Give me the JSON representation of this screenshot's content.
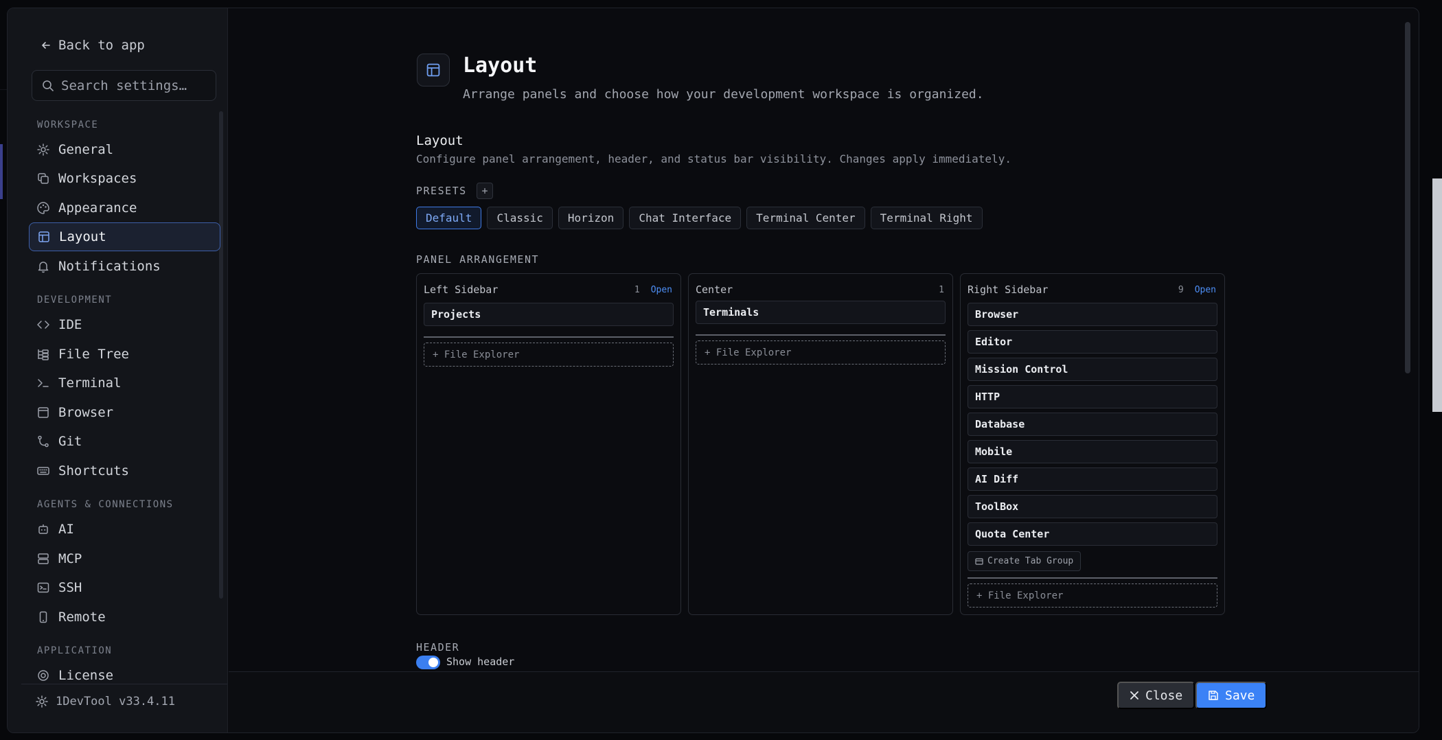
{
  "sidebar": {
    "back_label": "Back to app",
    "search_placeholder": "Search settings…",
    "groups": [
      {
        "label": "WORKSPACE"
      },
      {
        "label": "DEVELOPMENT"
      },
      {
        "label": "AGENTS & CONNECTIONS"
      },
      {
        "label": "APPLICATION"
      }
    ],
    "items": {
      "general": "General",
      "workspaces": "Workspaces",
      "appearance": "Appearance",
      "layout": "Layout",
      "notifications": "Notifications",
      "ide": "IDE",
      "file_tree": "File Tree",
      "terminal": "Terminal",
      "browser": "Browser",
      "git": "Git",
      "shortcuts": "Shortcuts",
      "ai": "AI",
      "mcp": "MCP",
      "ssh": "SSH",
      "remote": "Remote",
      "license": "License"
    },
    "active_item": "Layout",
    "version": "1DevTool v33.4.11"
  },
  "page": {
    "title": "Layout",
    "description": "Arrange panels and choose how your development workspace is organized.",
    "section_title": "Layout",
    "section_description": "Configure panel arrangement, header, and status bar visibility. Changes apply immediately.",
    "presets_label": "PRESETS",
    "add_preset_label": "+",
    "presets": [
      "Default",
      "Classic",
      "Horizon",
      "Chat Interface",
      "Terminal Center",
      "Terminal Right"
    ],
    "active_preset": "Default",
    "panel_arrangement_label": "PANEL ARRANGEMENT",
    "panels": {
      "left": {
        "title": "Left Sidebar",
        "count": "1",
        "open_label": "Open",
        "tabs": [
          "Projects"
        ],
        "dropzone": "+ File Explorer"
      },
      "center": {
        "title": "Center",
        "count": "1",
        "tabs": [
          "Terminals"
        ],
        "dropzone": "+ File Explorer"
      },
      "right": {
        "title": "Right Sidebar",
        "count": "9",
        "open_label": "Open",
        "tabs": [
          "Browser",
          "Editor",
          "Mission Control",
          "HTTP",
          "Database",
          "Mobile",
          "AI Diff",
          "ToolBox",
          "Quota Center"
        ],
        "create_group_label": "Create Tab Group",
        "dropzone": "+ File Explorer"
      }
    },
    "header_label": "HEADER",
    "show_header_label": "Show header",
    "show_header_enabled": true
  },
  "footer": {
    "close_label": "Close",
    "save_label": "Save"
  },
  "colors": {
    "accent": "#3b82f6",
    "background": "#0a0b0f",
    "sidebar": "#13151a"
  }
}
